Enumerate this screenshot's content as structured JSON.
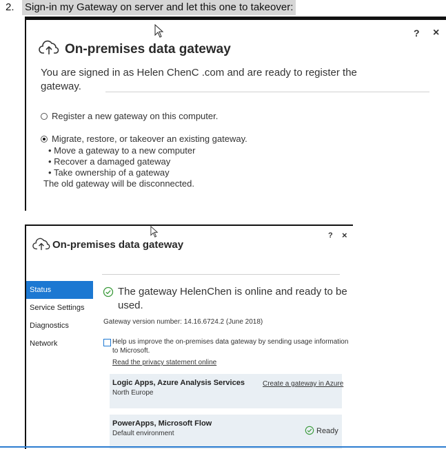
{
  "step": {
    "number": "2.",
    "text": "Sign-in my Gateway on server and let this one to takeover:"
  },
  "dialog1": {
    "title": "On-premises data gateway",
    "help": "?",
    "close": "×",
    "signed_in_line1": "You are signed in as Helen ChenC            .com and are ready to register the",
    "signed_in_line2": "gateway.",
    "options": [
      {
        "label": "Register a new gateway on this computer.",
        "selected": false
      },
      {
        "label": "Migrate, restore, or takeover an existing gateway.",
        "selected": true
      }
    ],
    "bullets": [
      "Move a gateway to a new computer",
      "Recover a damaged gateway",
      "Take ownership of a gateway"
    ],
    "note": "The old gateway will be disconnected."
  },
  "dialog2": {
    "title": "On-premises data gateway",
    "help": "?",
    "close": "×",
    "sidebar": [
      "Status",
      "Service Settings",
      "Diagnostics",
      "Network"
    ],
    "status_line1": "The gateway HelenChen is online and ready to be",
    "status_line2": "used.",
    "version": "Gateway version number: 14.16.6724.2 (June 2018)",
    "help_improve_line1": "Help us improve the on-premises data gateway by sending usage information",
    "help_improve_line2": "to Microsoft.",
    "privacy_link": "Read the privacy statement online",
    "panel1": {
      "title": "Logic Apps, Azure Analysis Services",
      "region": "North Europe",
      "link": "Create a gateway in Azure"
    },
    "panel2": {
      "title": "PowerApps, Microsoft Flow",
      "env": "Default environment",
      "status": "Ready"
    }
  },
  "colors": {
    "accent": "#1c78d2",
    "success": "#3a9a3a",
    "panel_bg": "#e9eff4",
    "highlight": "#d6d6d6"
  }
}
